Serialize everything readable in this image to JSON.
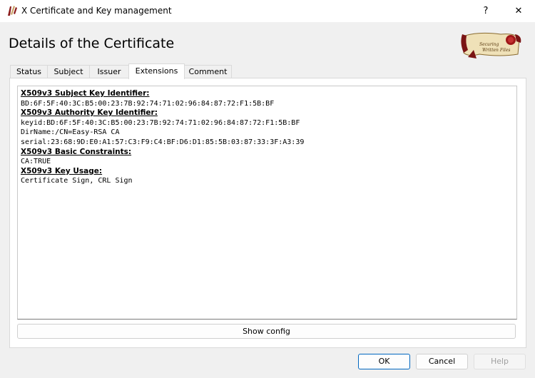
{
  "window": {
    "title": "X Certificate and Key management",
    "help_glyph": "?",
    "close_glyph": "✕"
  },
  "dialog": {
    "heading": "Details of the Certificate",
    "logo_text": "Securing Written Files"
  },
  "tabs": [
    {
      "label": "Status"
    },
    {
      "label": "Subject"
    },
    {
      "label": "Issuer"
    },
    {
      "label": "Extensions",
      "active": true
    },
    {
      "label": "Comment"
    }
  ],
  "extensions": {
    "ski_header": "X509v3 Subject Key Identifier:",
    "ski_value": "BD:6F:5F:40:3C:B5:00:23:7B:92:74:71:02:96:84:87:72:F1:5B:BF",
    "aki_header": "X509v3 Authority Key Identifier:",
    "aki_keyid": "keyid:BD:6F:5F:40:3C:B5:00:23:7B:92:74:71:02:96:84:87:72:F1:5B:BF",
    "aki_dirname": "DirName:/CN=Easy-RSA CA",
    "aki_serial": "serial:23:68:9D:E0:A1:57:C3:F9:C4:BF:D6:D1:85:5B:03:87:33:3F:A3:39",
    "bc_header": "X509v3 Basic Constraints:",
    "bc_value": "CA:TRUE",
    "ku_header": "X509v3 Key Usage:",
    "ku_value": "Certificate Sign, CRL Sign"
  },
  "buttons": {
    "show_config": "Show config",
    "ok": "OK",
    "cancel": "Cancel",
    "help": "Help"
  }
}
